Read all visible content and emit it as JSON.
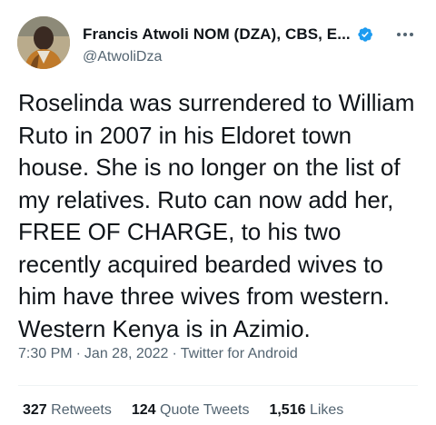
{
  "author": {
    "display_name": "Francis Atwoli NOM (DZA), CBS, E...",
    "handle": "@AtwoliDza",
    "avatar_icon": "profile-photo",
    "verified_icon": "verified-badge-icon",
    "verified_color": "#1d9bf0"
  },
  "tweet": {
    "text": "Roselinda was surrendered to William Ruto in 2007 in his Eldoret town house. She is no longer on the list of my relatives. Ruto can now add her, FREE OF CHARGE, to his  two recently acquired bearded wives to him have three wives from western. Western Kenya is in Azimio."
  },
  "meta": {
    "time": "7:30 PM",
    "separator": "·",
    "date": "Jan 28, 2022",
    "source": "Twitter for Android"
  },
  "stats": {
    "retweets_count": "327",
    "retweets_label": "Retweets",
    "quotes_count": "124",
    "quotes_label": "Quote Tweets",
    "likes_count": "1,516",
    "likes_label": "Likes"
  },
  "colors": {
    "text": "#0f1419",
    "secondary": "#536471",
    "divider": "#eff3f4"
  }
}
